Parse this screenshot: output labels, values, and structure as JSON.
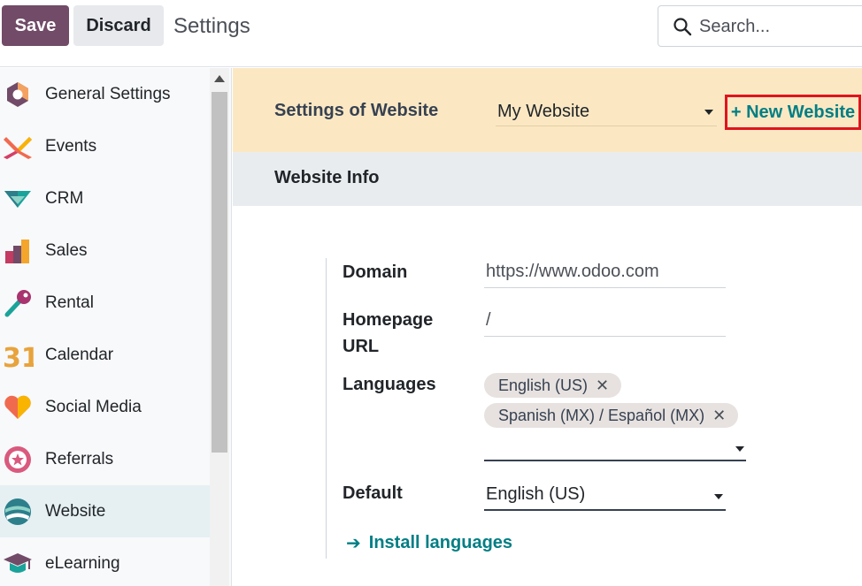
{
  "toolbar": {
    "save_label": "Save",
    "discard_label": "Discard",
    "title": "Settings"
  },
  "search": {
    "placeholder": "Search...",
    "icon": "search-icon"
  },
  "sidebar": {
    "items": [
      {
        "label": "General Settings",
        "icon": "general-settings-icon",
        "active": false
      },
      {
        "label": "Events",
        "icon": "events-icon",
        "active": false
      },
      {
        "label": "CRM",
        "icon": "crm-icon",
        "active": false
      },
      {
        "label": "Sales",
        "icon": "sales-icon",
        "active": false
      },
      {
        "label": "Rental",
        "icon": "rental-icon",
        "active": false
      },
      {
        "label": "Calendar",
        "icon": "calendar-icon",
        "active": false
      },
      {
        "label": "Social Media",
        "icon": "social-media-icon",
        "active": false
      },
      {
        "label": "Referrals",
        "icon": "referrals-icon",
        "active": false
      },
      {
        "label": "Website",
        "icon": "website-icon",
        "active": true
      },
      {
        "label": "eLearning",
        "icon": "elearning-icon",
        "active": false
      }
    ],
    "calendar_icon_text": "31"
  },
  "website_bar": {
    "label": "Settings of Website",
    "selected": "My Website",
    "new_button": "+ New Website"
  },
  "section": {
    "title": "Website Info"
  },
  "form": {
    "domain": {
      "label": "Domain",
      "value": "https://www.odoo.com"
    },
    "homepage": {
      "label_line1": "Homepage",
      "label_line2": "URL",
      "value": "/"
    },
    "languages": {
      "label": "Languages",
      "tags": [
        "English (US)",
        "Spanish (MX) / Español (MX)"
      ],
      "remove_glyph": "✕"
    },
    "default": {
      "label": "Default",
      "value": "English (US)"
    },
    "install_link": {
      "arrow": "➔",
      "label": "Install languages"
    }
  },
  "colors": {
    "brand": "#714b67",
    "link": "#017e84",
    "highlight_border": "#e0141e",
    "website_bar_bg": "#fbe8c3",
    "active_item_bg": "#e6f0f3"
  }
}
